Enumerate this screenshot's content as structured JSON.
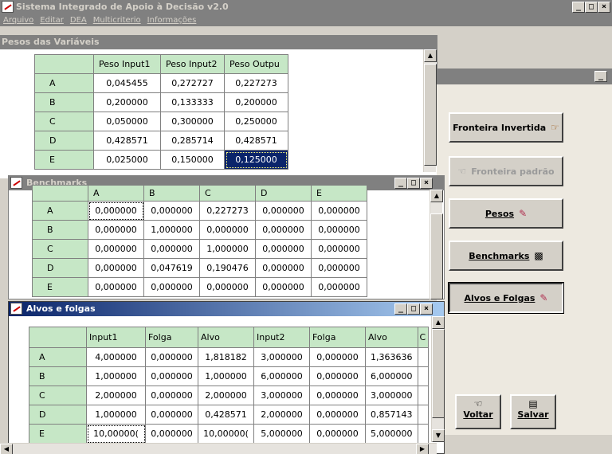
{
  "app": {
    "title": "Sistema Integrado de Apoio à Decisão v2.0",
    "menu": [
      "Arquivo",
      "Editar",
      "DEA",
      "Multicriterio",
      "Informações"
    ]
  },
  "pesos": {
    "title": "Pesos das Variáveis",
    "headers": [
      "Peso Input1",
      "Peso Input2",
      "Peso Outpu"
    ],
    "rows": [
      {
        "label": "A",
        "values": [
          "0,045455",
          "0,272727",
          "0,227273"
        ]
      },
      {
        "label": "B",
        "values": [
          "0,200000",
          "0,133333",
          "0,200000"
        ]
      },
      {
        "label": "C",
        "values": [
          "0,050000",
          "0,300000",
          "0,250000"
        ]
      },
      {
        "label": "D",
        "values": [
          "0,428571",
          "0,285714",
          "0,428571"
        ]
      },
      {
        "label": "E",
        "values": [
          "0,025000",
          "0,150000",
          "0,125000"
        ]
      }
    ]
  },
  "benchmarks": {
    "title": "Benchmarks",
    "headers": [
      "A",
      "B",
      "C",
      "D",
      "E"
    ],
    "rows": [
      {
        "label": "A",
        "values": [
          "0,000000",
          "0,000000",
          "0,227273",
          "0,000000",
          "0,000000"
        ]
      },
      {
        "label": "B",
        "values": [
          "0,000000",
          "1,000000",
          "0,000000",
          "0,000000",
          "0,000000"
        ]
      },
      {
        "label": "C",
        "values": [
          "0,000000",
          "0,000000",
          "1,000000",
          "0,000000",
          "0,000000"
        ]
      },
      {
        "label": "D",
        "values": [
          "0,000000",
          "0,047619",
          "0,190476",
          "0,000000",
          "0,000000"
        ]
      },
      {
        "label": "E",
        "values": [
          "0,000000",
          "0,000000",
          "0,000000",
          "0,000000",
          "0,000000"
        ]
      }
    ]
  },
  "alvos": {
    "title": "Alvos e folgas",
    "headers": [
      "Input1",
      "Folga",
      "Alvo",
      "Input2",
      "Folga",
      "Alvo",
      "C"
    ],
    "rows": [
      {
        "label": "A",
        "values": [
          "4,000000",
          "0,000000",
          "1,818182",
          "3,000000",
          "0,000000",
          "1,363636"
        ]
      },
      {
        "label": "B",
        "values": [
          "1,000000",
          "0,000000",
          "1,000000",
          "6,000000",
          "0,000000",
          "6,000000"
        ]
      },
      {
        "label": "C",
        "values": [
          "2,000000",
          "0,000000",
          "2,000000",
          "3,000000",
          "0,000000",
          "3,000000"
        ]
      },
      {
        "label": "D",
        "values": [
          "1,000000",
          "0,000000",
          "0,428571",
          "2,000000",
          "0,000000",
          "0,857143"
        ]
      },
      {
        "label": "E",
        "values": [
          "10,00000(",
          "0,000000",
          "10,00000(",
          "5,000000",
          "0,000000",
          "5,000000"
        ]
      }
    ]
  },
  "side": {
    "fronteira_invertida": "Fronteira Invertida",
    "fronteira_padrao": "Fronteira padrão",
    "pesos": "Pesos",
    "benchmarks": "Benchmarks",
    "alvos_folgas": "Alvos e Folgas",
    "voltar": "Voltar",
    "salvar": "Salvar"
  }
}
